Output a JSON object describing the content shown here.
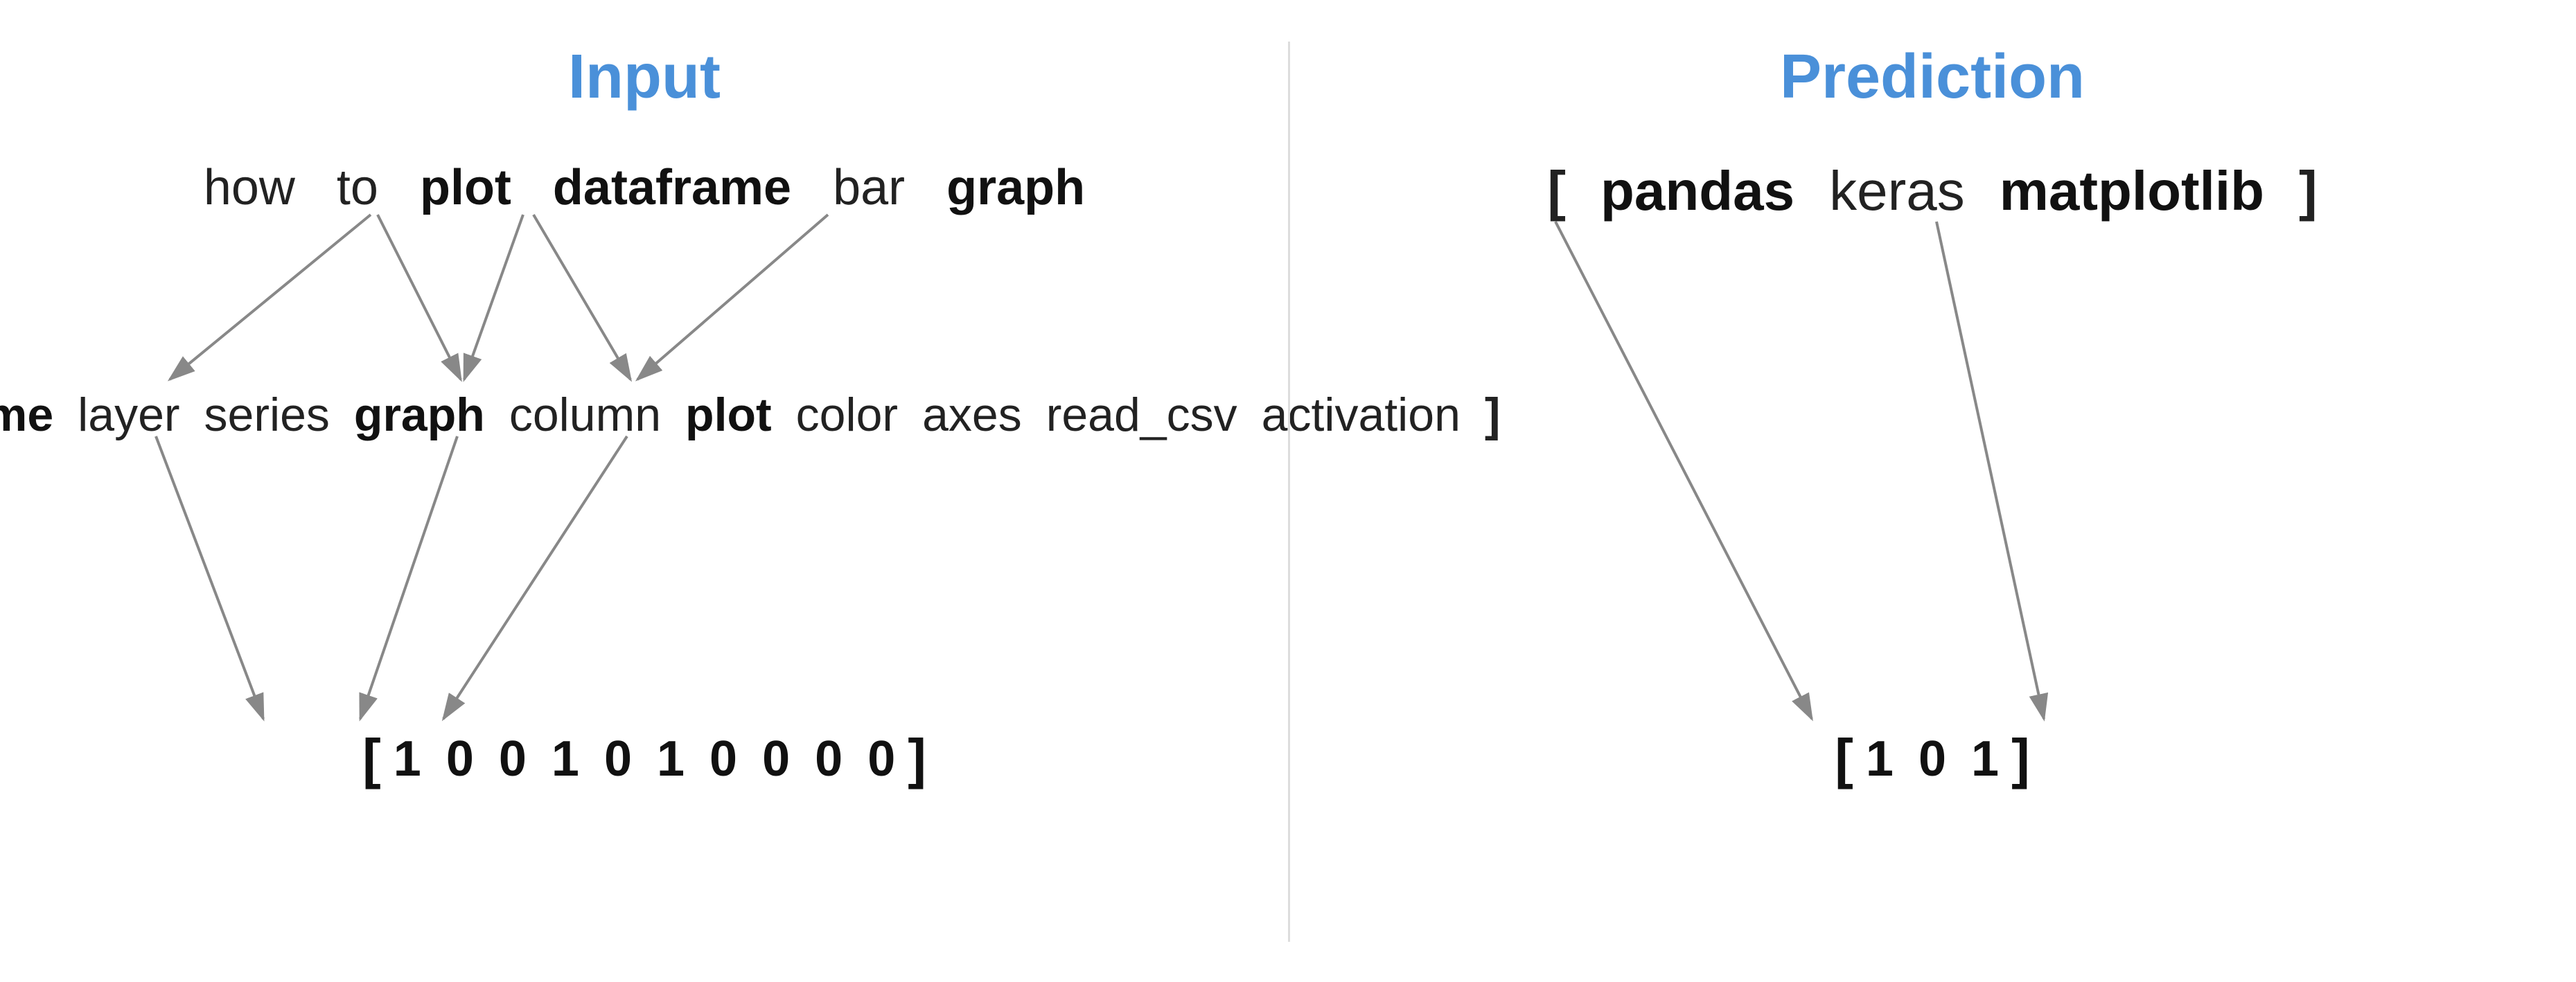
{
  "input": {
    "title": "Input",
    "words_row1": [
      {
        "text": "how",
        "bold": false
      },
      {
        "text": "to",
        "bold": false
      },
      {
        "text": "plot",
        "bold": true
      },
      {
        "text": "dataframe",
        "bold": true
      },
      {
        "text": "bar",
        "bold": false
      },
      {
        "text": "graph",
        "bold": true
      }
    ],
    "words_row2": [
      {
        "text": "[",
        "bold": false,
        "bracket": true
      },
      {
        "text": "dataframe",
        "bold": true
      },
      {
        "text": "layer",
        "bold": false
      },
      {
        "text": "series",
        "bold": false
      },
      {
        "text": "graph",
        "bold": true
      },
      {
        "text": "column",
        "bold": false
      },
      {
        "text": "plot",
        "bold": true
      },
      {
        "text": "color",
        "bold": false
      },
      {
        "text": "axes",
        "bold": false
      },
      {
        "text": "read_csv",
        "bold": false
      },
      {
        "text": "activation",
        "bold": false
      },
      {
        "text": "]",
        "bold": false,
        "bracket": true
      }
    ],
    "output_vector": {
      "bracket_open": "[",
      "values": [
        "1",
        "0",
        "0",
        "1",
        "0",
        "1",
        "0",
        "0",
        "0",
        "0"
      ],
      "bracket_close": "]"
    }
  },
  "prediction": {
    "title": "Prediction",
    "words_row1": [
      {
        "text": "[",
        "bold": false,
        "bracket": true
      },
      {
        "text": "pandas",
        "bold": true
      },
      {
        "text": "keras",
        "bold": false
      },
      {
        "text": "matplotlib",
        "bold": true
      },
      {
        "text": "]",
        "bold": false,
        "bracket": true
      }
    ],
    "output_vector": {
      "bracket_open": "[",
      "values": [
        "1",
        "0",
        "1"
      ],
      "bracket_close": "]"
    }
  },
  "colors": {
    "title_blue": "#4A90D9",
    "arrow_color": "#888888",
    "text_dark": "#222222",
    "bracket_color": "#111111"
  }
}
